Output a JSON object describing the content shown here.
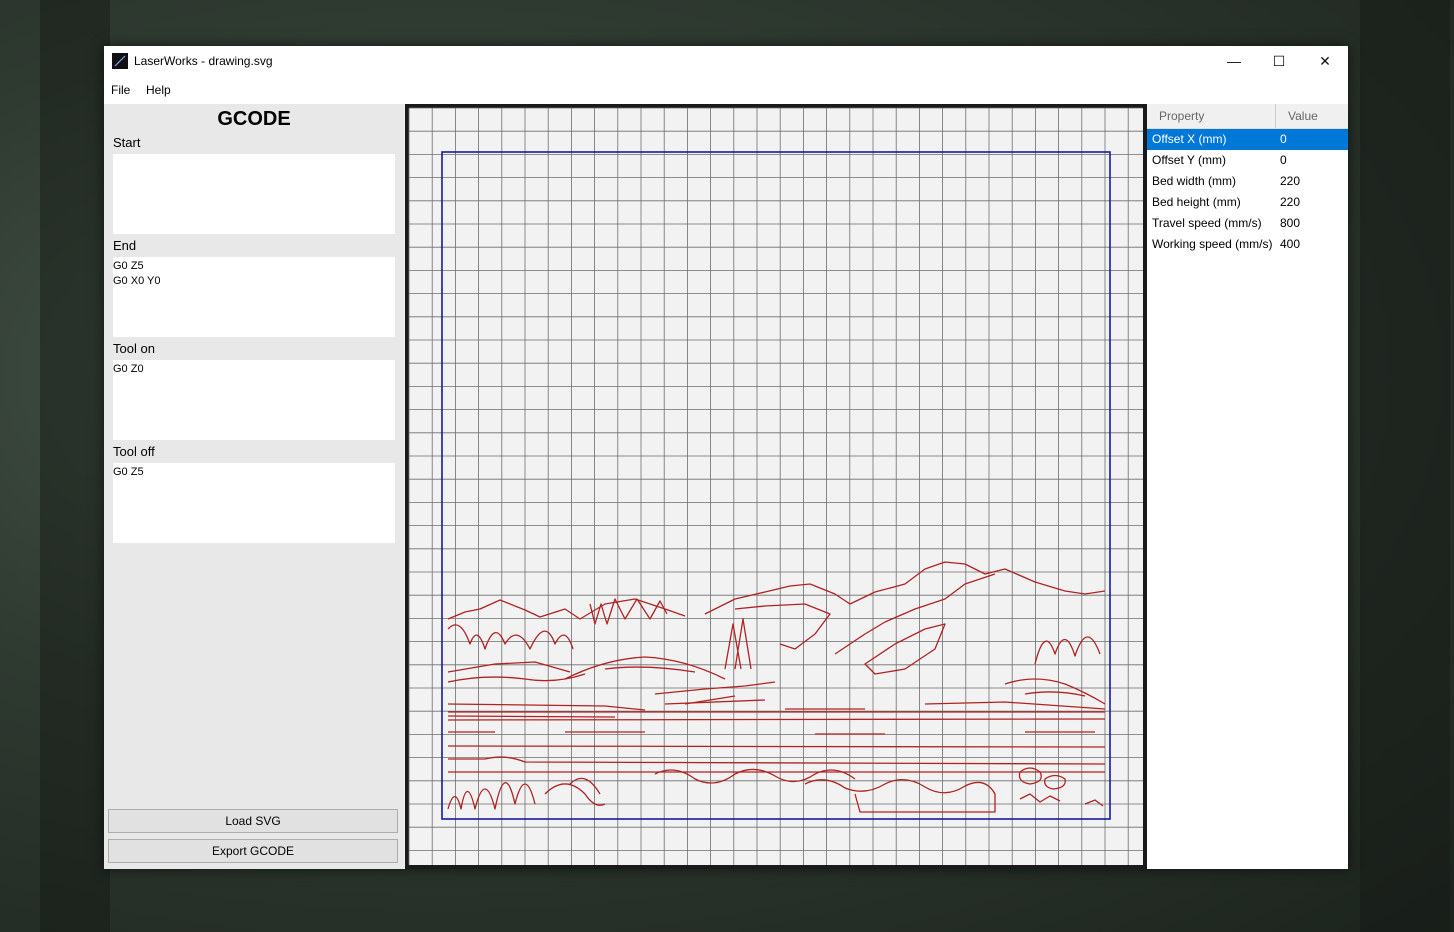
{
  "window": {
    "title": "LaserWorks - drawing.svg",
    "controls": {
      "minimize": "—",
      "maximize": "☐",
      "close": "✕"
    }
  },
  "menu": {
    "items": [
      "File",
      "Help"
    ]
  },
  "gcode_panel": {
    "title": "GCODE",
    "sections": [
      {
        "label": "Start",
        "value": ""
      },
      {
        "label": "End",
        "value": "G0 Z5\nG0 X0 Y0"
      },
      {
        "label": "Tool on",
        "value": "G0 Z0"
      },
      {
        "label": "Tool off",
        "value": "G0 Z5"
      }
    ],
    "buttons": {
      "load": "Load SVG",
      "export": "Export GCODE"
    }
  },
  "properties": {
    "headers": {
      "property": "Property",
      "value": "Value"
    },
    "rows": [
      {
        "name": "Offset X (mm)",
        "value": "0",
        "selected": true
      },
      {
        "name": "Offset Y (mm)",
        "value": "0"
      },
      {
        "name": "Bed width (mm)",
        "value": "220"
      },
      {
        "name": "Bed height (mm)",
        "value": "220"
      },
      {
        "name": "Travel speed (mm/s)",
        "value": "800"
      },
      {
        "name": "Working speed (mm/s)",
        "value": "400"
      }
    ]
  },
  "colors": {
    "selection": "#0078d7",
    "drawing_stroke": "#b22222",
    "bed_outline": "#1a1aa0",
    "grid_line": "#6e6e6e",
    "canvas_bg": "#f2f2f2"
  }
}
